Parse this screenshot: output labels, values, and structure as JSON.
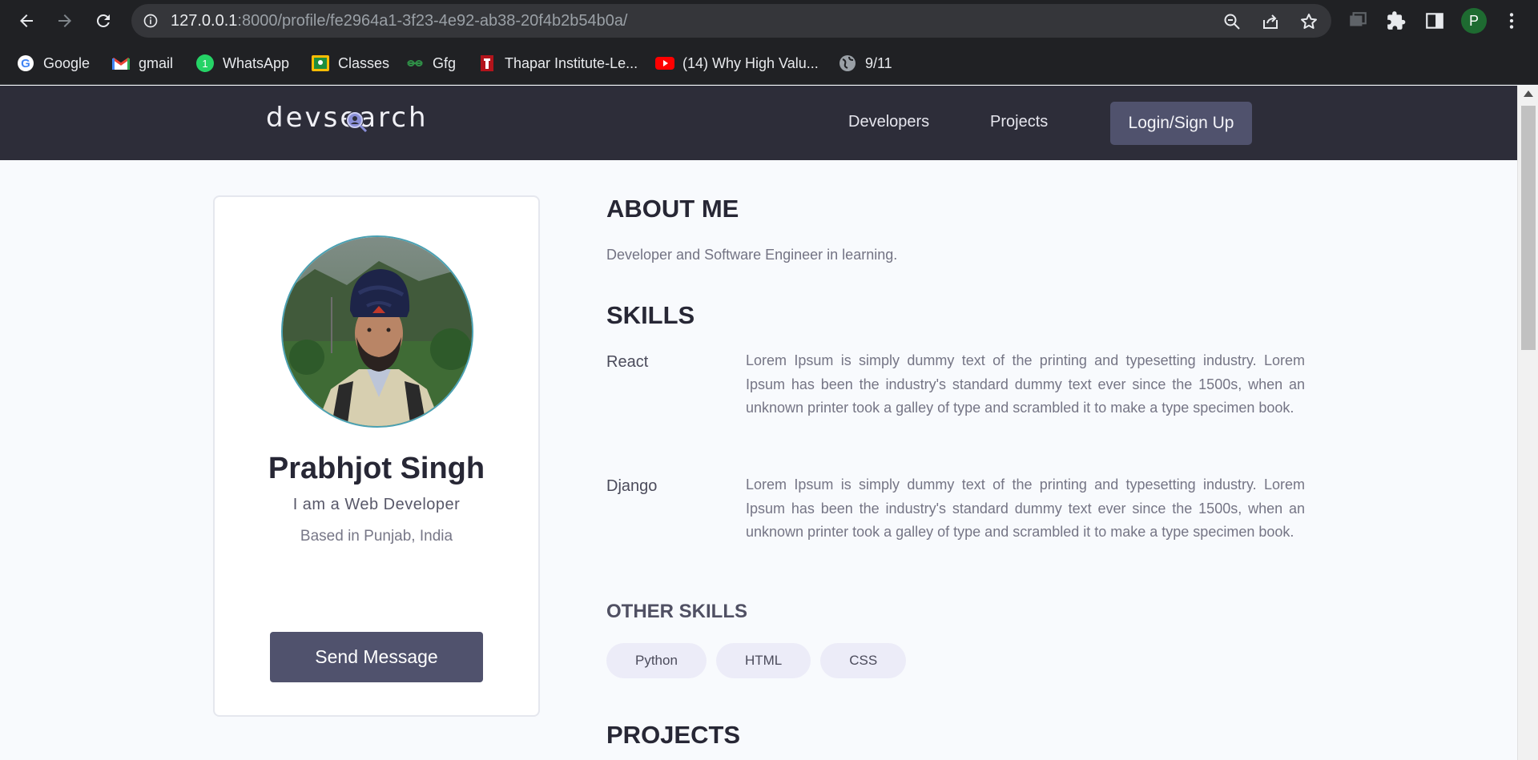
{
  "browser": {
    "url_host": "127.0.0.1",
    "url_path": ":8000/profile/fe2964a1-3f23-4e92-ab38-20f4b2b54b0a/",
    "profile_initial": "P",
    "bookmarks": [
      {
        "label": "Google",
        "icon": "google-icon"
      },
      {
        "label": "gmail",
        "icon": "gmail-icon"
      },
      {
        "label": "WhatsApp",
        "icon": "whatsapp-icon"
      },
      {
        "label": "Classes",
        "icon": "classroom-icon"
      },
      {
        "label": "Gfg",
        "icon": "gfg-icon"
      },
      {
        "label": "Thapar Institute-Le...",
        "icon": "thapar-icon"
      },
      {
        "label": "(14) Why High Valu...",
        "icon": "youtube-icon"
      },
      {
        "label": "9/11",
        "icon": "globe-icon"
      }
    ]
  },
  "site": {
    "logo_text": "devsearch",
    "nav": {
      "developers": "Developers",
      "projects": "Projects",
      "login": "Login/Sign Up"
    }
  },
  "profile": {
    "name": "Prabhjot Singh",
    "headline": "I am a Web Developer",
    "location": "Based in Punjab, India",
    "send_message": "Send Message"
  },
  "about": {
    "title": "ABOUT ME",
    "text": "Developer and Software Engineer in learning."
  },
  "skills": {
    "title": "SKILLS",
    "items": [
      {
        "name": "React",
        "description": "Lorem Ipsum is simply dummy text of the printing and typesetting industry. Lorem Ipsum has been the industry's standard dummy text ever since the 1500s, when an unknown printer took a galley of type and scrambled it to make a type specimen book."
      },
      {
        "name": "Django",
        "description": "Lorem Ipsum is simply dummy text of the printing and typesetting industry. Lorem Ipsum has been the industry's standard dummy text ever since the 1500s, when an unknown printer took a galley of type and scrambled it to make a type specimen book."
      }
    ]
  },
  "other_skills": {
    "title": "OTHER SKILLS",
    "tags": [
      "Python",
      "HTML",
      "CSS"
    ]
  },
  "projects": {
    "title": "PROJECTS"
  },
  "colors": {
    "header": "#2d2d39",
    "button": "#50526d",
    "tag_bg": "#ececf8",
    "page_bg": "#f8fafd"
  }
}
